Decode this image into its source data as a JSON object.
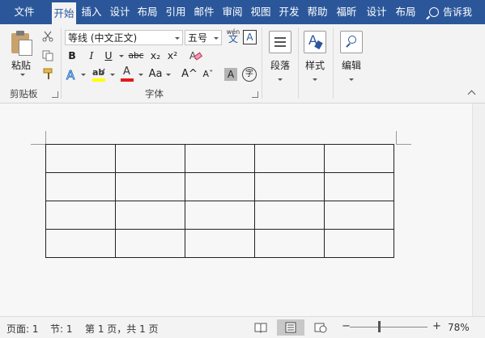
{
  "tabs": [
    "文件",
    "开始",
    "插入",
    "设计",
    "布局",
    "引用",
    "邮件",
    "审阅",
    "视图",
    "开发",
    "帮助",
    "福昕",
    "设计",
    "布局"
  ],
  "active_tab": 1,
  "tell_me": "告诉我",
  "clipboard": {
    "paste_label": "粘贴",
    "group_label": "剪贴板"
  },
  "font": {
    "font_name": "等线 (中文正文)",
    "font_size": "五号",
    "phonetic_glyph": "wén",
    "border_glyph": "A",
    "bold": "B",
    "italic": "I",
    "underline": "U",
    "strike": "abc",
    "subscript": "x₂",
    "superscript": "x²",
    "aa": "Aa",
    "grow": "A^",
    "shrink": "Aˇ",
    "shade_glyph": "A",
    "enclose_glyph": "字",
    "group_label": "字体"
  },
  "paragraph": {
    "label": "段落"
  },
  "styles": {
    "label": "样式"
  },
  "editing": {
    "label": "编辑"
  },
  "status": {
    "page": "页面: 1",
    "section": "节: 1",
    "page_of": "第 1 页，共 1 页",
    "zoom": "78%",
    "zoom_minus": "−",
    "zoom_plus": "+"
  },
  "table": {
    "rows": 4,
    "cols": 5
  },
  "colors": {
    "ribbon_blue": "#2b579a",
    "highlight_yellow": "#ffff00",
    "font_red": "#e31b1b"
  }
}
